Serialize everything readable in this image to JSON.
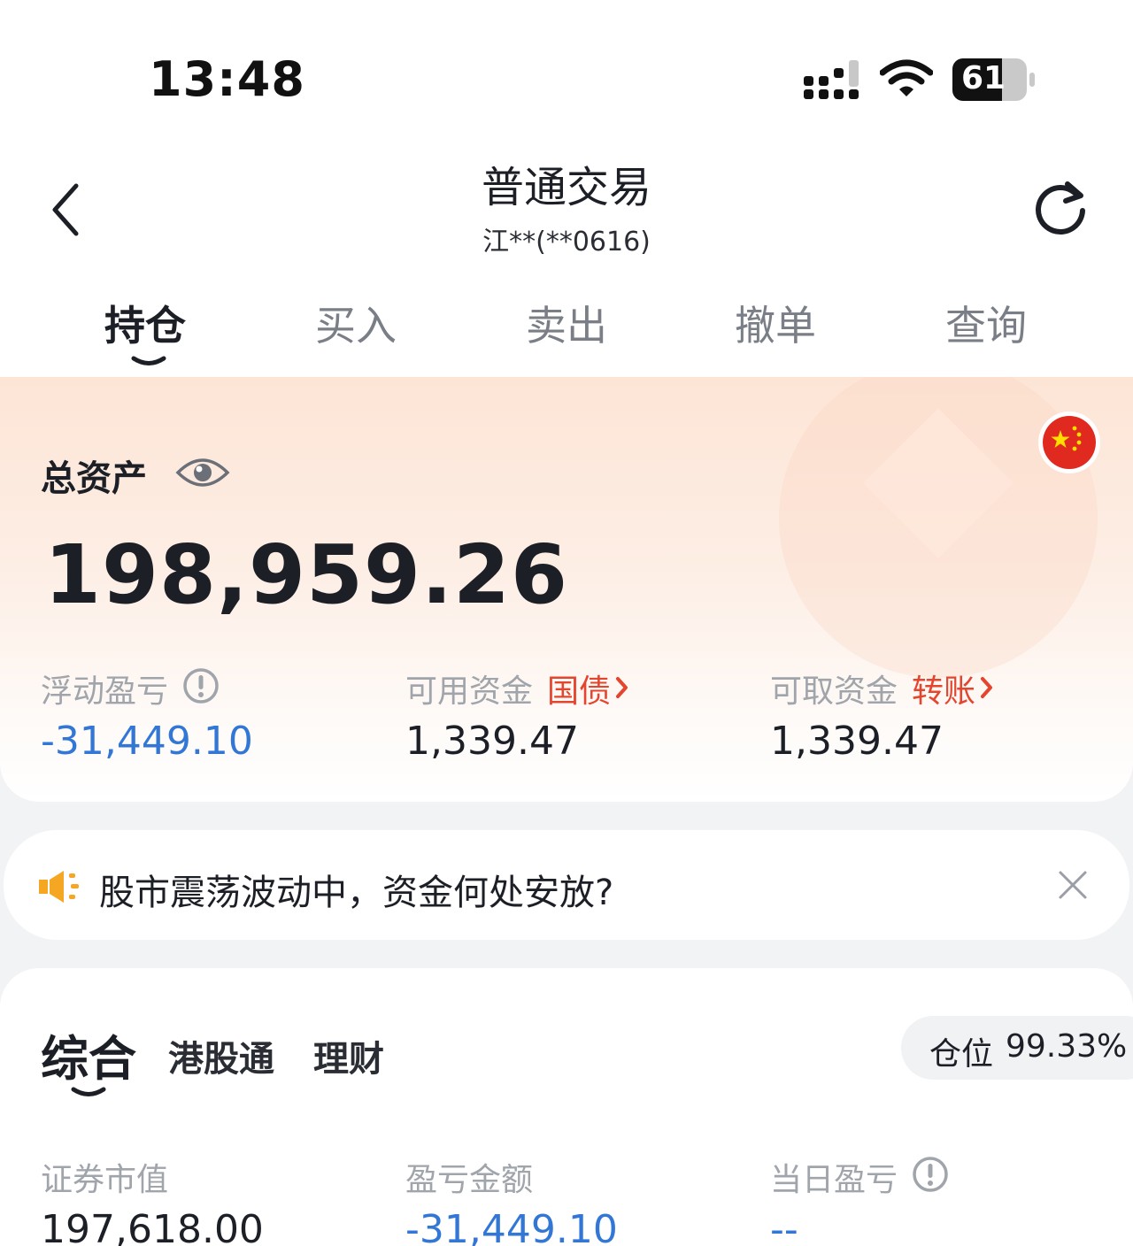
{
  "status_bar": {
    "time": "13:48",
    "battery": "61"
  },
  "header": {
    "title": "普通交易",
    "account": "江**(**0616)"
  },
  "tabs": [
    {
      "label": "持仓",
      "active": true
    },
    {
      "label": "买入"
    },
    {
      "label": "卖出"
    },
    {
      "label": "撤单"
    },
    {
      "label": "查询"
    }
  ],
  "assets": {
    "total_label": "总资产",
    "total_value": "198,959.26",
    "floating_pl_label": "浮动盈亏",
    "floating_pl_value": "-31,449.10",
    "available_label": "可用资金",
    "available_link": "国债",
    "available_value": "1,339.47",
    "withdrawable_label": "可取资金",
    "withdrawable_link": "转账",
    "withdrawable_value": "1,339.47"
  },
  "notice": {
    "text": "股市震荡波动中，资金何处安放?"
  },
  "position_panel": {
    "tabs": [
      "综合",
      "港股通",
      "理财"
    ],
    "position_label": "仓位",
    "position_value": "99.33%",
    "market_value_label": "证券市值",
    "market_value": "197,618.00",
    "pl_amount_label": "盈亏金额",
    "pl_amount": "-31,449.10",
    "daily_pl_label": "当日盈亏",
    "daily_pl": "--"
  },
  "colors": {
    "accent_red": "#e4452e",
    "loss_blue": "#3377d6",
    "card_peach": "#fde5d6"
  },
  "icons": [
    "back-icon",
    "refresh-icon",
    "eye-icon",
    "info-icon",
    "flag-icon",
    "speaker-icon",
    "close-icon",
    "chevron-right-icon"
  ]
}
